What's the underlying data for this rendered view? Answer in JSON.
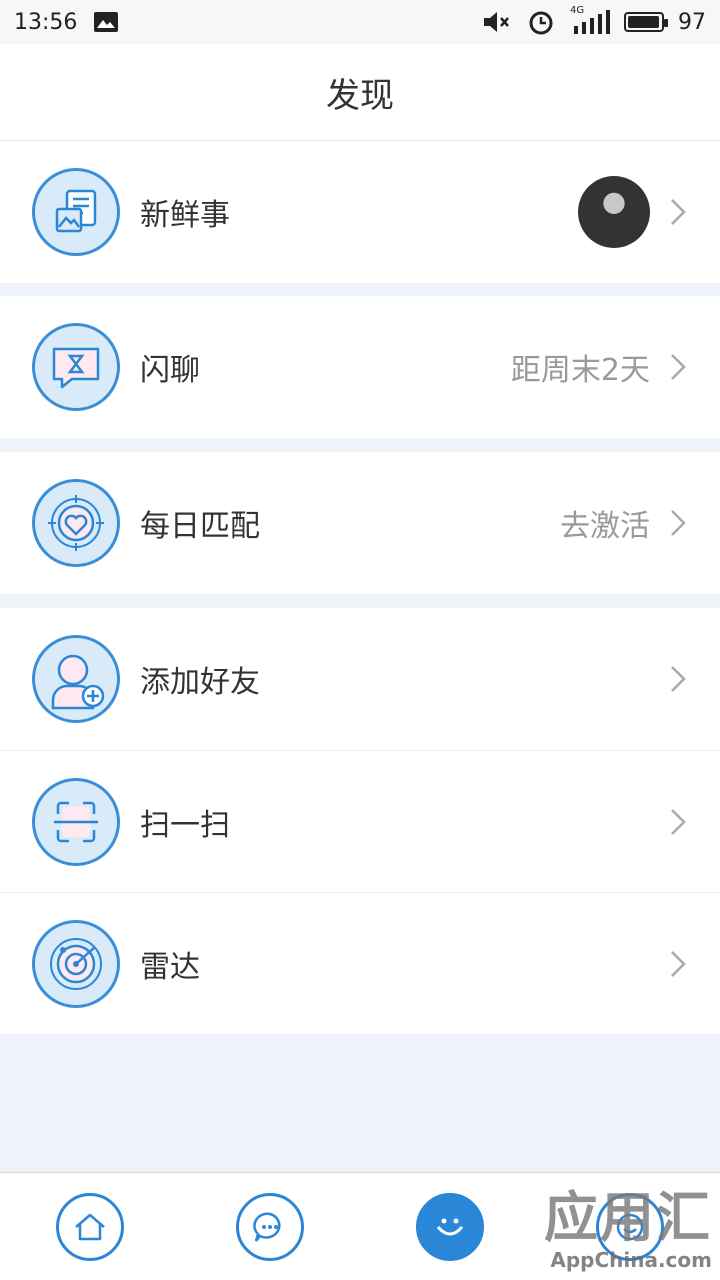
{
  "status_bar": {
    "time": "13:56",
    "network": "4G",
    "battery": "97",
    "battery_level": 0.97,
    "icons": [
      "gallery-icon",
      "mute-icon",
      "alarm-icon",
      "signal-icon",
      "battery-icon"
    ]
  },
  "header": {
    "title": "发现"
  },
  "rows": [
    {
      "label": "新鲜事",
      "status": "",
      "icon": "news-feed-icon",
      "has_avatar": true
    },
    {
      "label": "闪聊",
      "status": "距周末2天",
      "icon": "flash-chat-icon"
    },
    {
      "label": "每日匹配",
      "status": "去激活",
      "icon": "daily-match-icon"
    },
    {
      "label": "添加好友",
      "status": "",
      "icon": "add-friend-icon"
    },
    {
      "label": "扫一扫",
      "status": "",
      "icon": "scan-icon"
    },
    {
      "label": "雷达",
      "status": "",
      "icon": "radar-icon"
    }
  ],
  "tabbar": {
    "tabs": [
      {
        "icon": "home-icon",
        "active": false
      },
      {
        "icon": "messages-icon",
        "active": false
      },
      {
        "icon": "discover-icon",
        "active": true
      },
      {
        "icon": "profile-icon",
        "active": false
      }
    ]
  },
  "watermark": {
    "title": "应用汇",
    "sub": "AppChina.com"
  },
  "colors": {
    "accent": "#2a86d6",
    "icon_bg": "#d9eaf8",
    "page_bg": "#eef3f9",
    "muted_text": "#9a9a9a"
  }
}
